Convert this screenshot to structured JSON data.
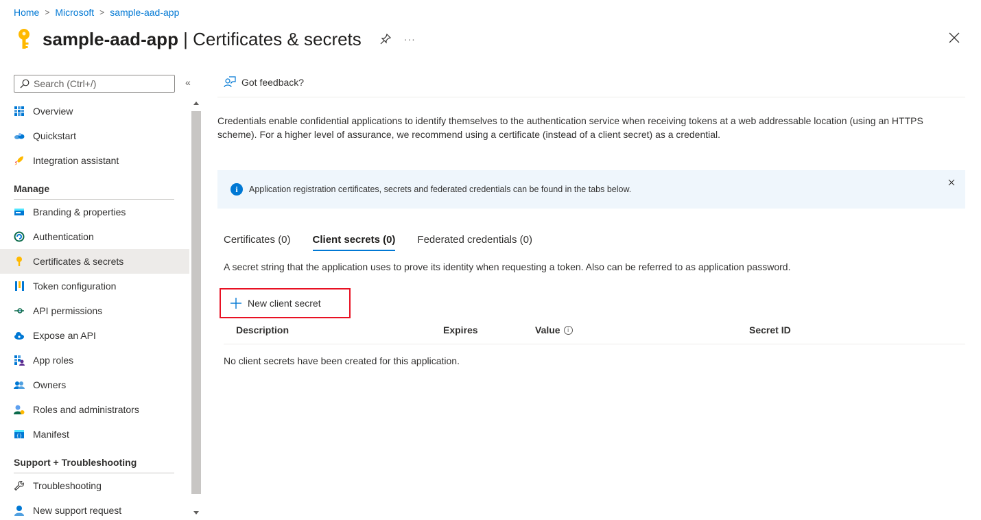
{
  "breadcrumb": [
    {
      "label": "Home"
    },
    {
      "label": "Microsoft"
    },
    {
      "label": "sample-aad-app"
    }
  ],
  "header": {
    "app_name": "sample-aad-app",
    "page_suffix": " | Certificates & secrets",
    "more_label": "···"
  },
  "sidebar": {
    "search_placeholder": "Search (Ctrl+/)",
    "collapse_label": "«",
    "top_items": [
      {
        "label": "Overview",
        "icon": "overview-icon"
      },
      {
        "label": "Quickstart",
        "icon": "quickstart-icon"
      },
      {
        "label": "Integration assistant",
        "icon": "rocket-icon"
      }
    ],
    "manage_header": "Manage",
    "manage_items": [
      {
        "label": "Branding & properties",
        "icon": "branding-icon"
      },
      {
        "label": "Authentication",
        "icon": "authentication-icon"
      },
      {
        "label": "Certificates & secrets",
        "icon": "key-icon",
        "active": true
      },
      {
        "label": "Token configuration",
        "icon": "token-icon"
      },
      {
        "label": "API permissions",
        "icon": "api-permissions-icon"
      },
      {
        "label": "Expose an API",
        "icon": "cloud-icon"
      },
      {
        "label": "App roles",
        "icon": "app-roles-icon"
      },
      {
        "label": "Owners",
        "icon": "owners-icon"
      },
      {
        "label": "Roles and administrators",
        "icon": "roles-icon"
      },
      {
        "label": "Manifest",
        "icon": "manifest-icon"
      }
    ],
    "support_header": "Support + Troubleshooting",
    "support_items": [
      {
        "label": "Troubleshooting",
        "icon": "wrench-icon"
      },
      {
        "label": "New support request",
        "icon": "support-icon"
      }
    ]
  },
  "main": {
    "feedback_label": "Got feedback?",
    "description": "Credentials enable confidential applications to identify themselves to the authentication service when receiving tokens at a web addressable location (using an HTTPS scheme). For a higher level of assurance, we recommend using a certificate (instead of a client secret) as a credential.",
    "info_bar": "Application registration certificates, secrets and federated credentials can be found in the tabs below.",
    "tabs": [
      {
        "label": "Certificates (0)"
      },
      {
        "label": "Client secrets (0)",
        "active": true
      },
      {
        "label": "Federated credentials (0)"
      }
    ],
    "tab_description": "A secret string that the application uses to prove its identity when requesting a token. Also can be referred to as application password.",
    "new_secret_label": "New client secret",
    "columns": [
      "Description",
      "Expires",
      "Value",
      "Secret ID"
    ],
    "empty_message": "No client secrets have been created for this application."
  },
  "colors": {
    "accent": "#0078d4",
    "highlight_border": "#e81123",
    "info_background": "#eff6fc"
  }
}
